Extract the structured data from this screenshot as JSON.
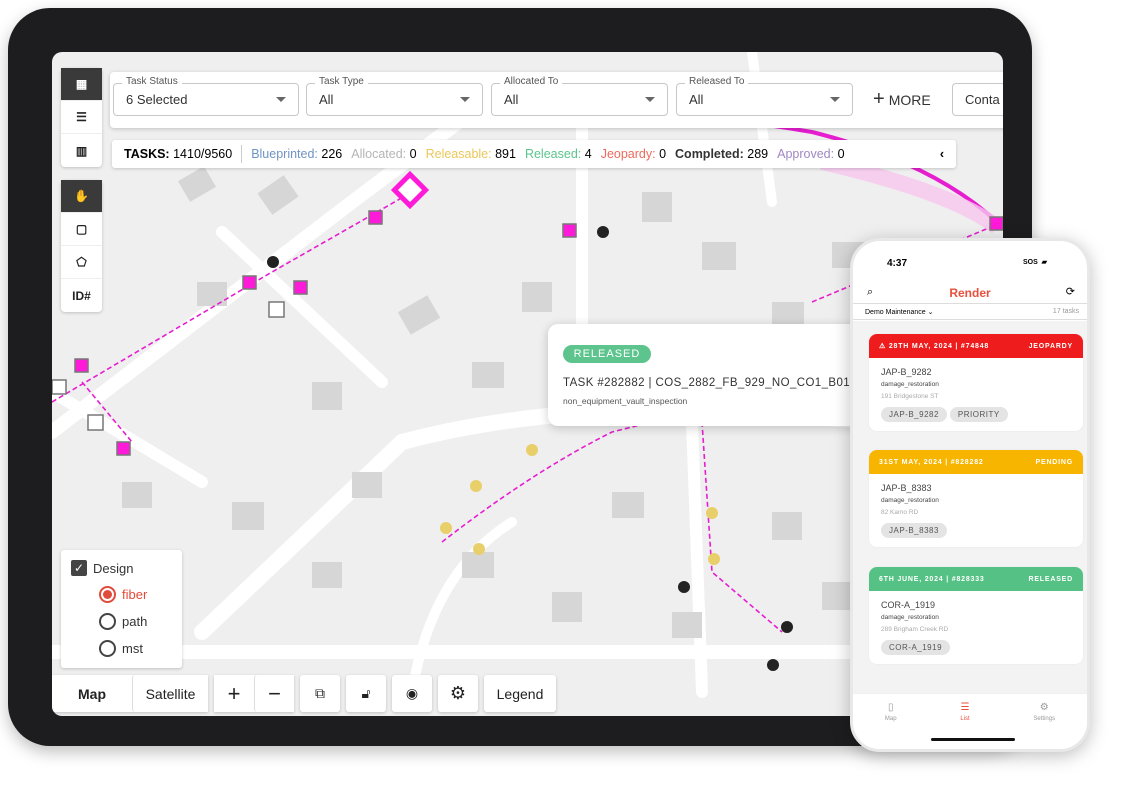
{
  "filters": [
    {
      "label": "Task Status",
      "value": "6 Selected"
    },
    {
      "label": "Task Type",
      "value": "All"
    },
    {
      "label": "Allocated To",
      "value": "All"
    },
    {
      "label": "Released To",
      "value": "All"
    }
  ],
  "more_label": "MORE",
  "contact_partial": "Conta",
  "stats": {
    "tasks_label": "TASKS:",
    "tasks_value": "1410/9560",
    "items": [
      {
        "label": "Blueprinted:",
        "value": "226",
        "color": "#6f93c6"
      },
      {
        "label": "Allocated:",
        "value": "0",
        "color": "#b5b5b5"
      },
      {
        "label": "Releasable:",
        "value": "891",
        "color": "#ecc75a"
      },
      {
        "label": "Released:",
        "value": "4",
        "color": "#5cc48c"
      },
      {
        "label": "Jeopardy:",
        "value": "0",
        "color": "#ec6a5c"
      },
      {
        "label": "Completed:",
        "value": "289",
        "color": "#333333"
      },
      {
        "label": "Approved:",
        "value": "0",
        "color": "#a187c4"
      }
    ]
  },
  "toolbar_top": [
    "map-icon",
    "list-icon",
    "chart-icon"
  ],
  "toolbar_mid": [
    "hand-icon",
    "square-select-icon",
    "polygon-select-icon"
  ],
  "id_label": "ID#",
  "legend": {
    "group": "Design",
    "options": [
      "fiber",
      "path",
      "mst"
    ],
    "selected": "fiber"
  },
  "bottom": {
    "map": "Map",
    "satellite": "Satellite",
    "zoom_in": "+",
    "zoom_out": "−",
    "legend": "Legend"
  },
  "popup": {
    "status": "RELEASED",
    "title": "TASK #282882 | COS_2882_FB_929_NO_CO1_B01",
    "subtitle": "non_equipment_vault_inspection"
  },
  "phone": {
    "time": "4:37",
    "sos": "SOS",
    "brand": "Render",
    "project": "Demo Maintenance",
    "count": "17 tasks",
    "cards": [
      {
        "header": "28TH MAY, 2024 | #74848",
        "status": "JEOPARDY",
        "color": "#ee1c1c",
        "title": "JAP-B_9282",
        "type": "damage_restoration",
        "address": "191 Bridgestone ST",
        "tags": [
          "JAP-B_9282",
          "PRIORITY"
        ]
      },
      {
        "header": "31ST MAY, 2024 | #828282",
        "status": "PENDING",
        "color": "#f7b500",
        "title": "JAP-B_8383",
        "type": "damage_restoration",
        "address": "82 Kamo RD",
        "tags": [
          "JAP-B_8383"
        ]
      },
      {
        "header": "6TH JUNE, 2024 | #828333",
        "status": "RELEASED",
        "color": "#55c184",
        "title": "COR-A_1919",
        "type": "damage_restoration",
        "address": "289 Brigham Creek RD",
        "tags": [
          "COR-A_1919"
        ]
      }
    ],
    "nav": [
      "Map",
      "List",
      "Settings"
    ],
    "accent": "#e8503e"
  }
}
